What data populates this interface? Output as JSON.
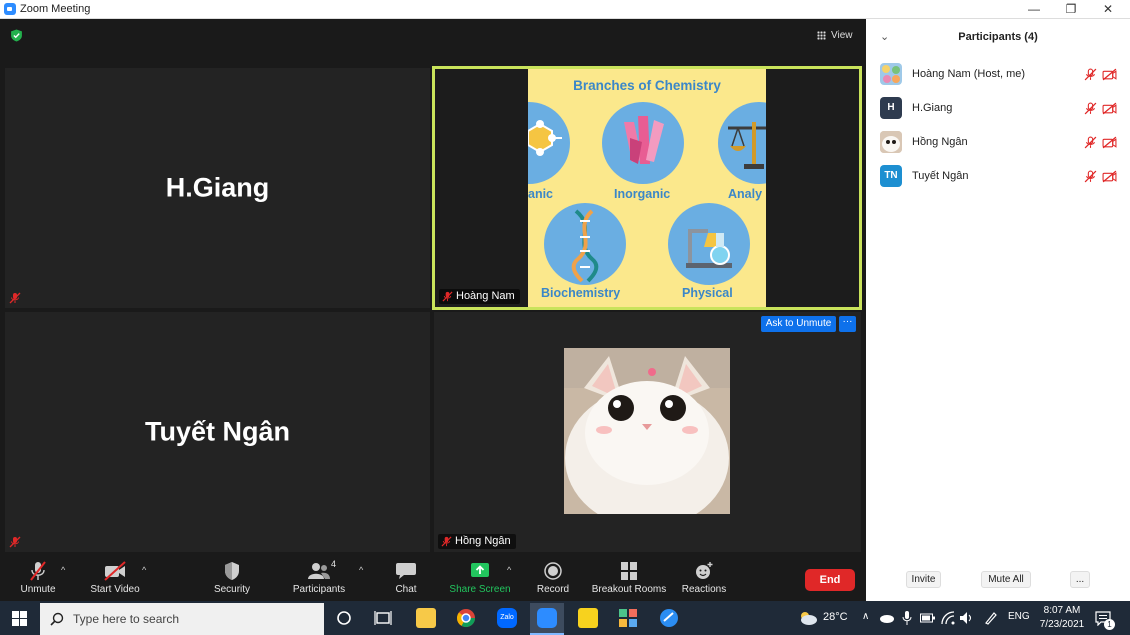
{
  "window": {
    "title": "Zoom Meeting",
    "minimize": "—",
    "restore": "❐",
    "close": "✕"
  },
  "stage": {
    "view_label": "View"
  },
  "tiles": {
    "h_giang": {
      "name": "H.Giang"
    },
    "tuyet_ngan": {
      "name": "Tuyết Ngân"
    },
    "hoang_nam": {
      "name": "Hoàng Nam"
    },
    "hong_ngan": {
      "name": "Hồng Ngân",
      "ask_unmute": "Ask to Unmute",
      "more": "···"
    }
  },
  "slide": {
    "title": "Branches of Chemistry",
    "labels": {
      "organic": "anic",
      "inorganic": "Inorganic",
      "analytical": "Analy",
      "biochemistry": "Biochemistry",
      "physical": "Physical"
    }
  },
  "toolbar": {
    "unmute": "Unmute",
    "start_video": "Start Video",
    "security": "Security",
    "participants": "Participants",
    "participants_count": "4",
    "chat": "Chat",
    "share_screen": "Share Screen",
    "record": "Record",
    "breakout_rooms": "Breakout Rooms",
    "reactions": "Reactions",
    "end": "End",
    "caret": "^"
  },
  "panel": {
    "title": "Participants (4)",
    "participants": [
      {
        "name": "Hoàng Nam (Host, me)",
        "avatar": "",
        "avatar_color": "#9fc9e8"
      },
      {
        "name": "H.Giang",
        "avatar": "H",
        "avatar_color": "#2e3b4f"
      },
      {
        "name": "Hồng Ngân",
        "avatar": "",
        "avatar_color": "#d9c7b5"
      },
      {
        "name": "Tuyết Ngân",
        "avatar": "TN",
        "avatar_color": "#1d8fd1"
      }
    ],
    "invite": "Invite",
    "mute_all": "Mute All",
    "more": "..."
  },
  "taskbar": {
    "search_placeholder": "Type here to search",
    "weather": "28°C",
    "language": "ENG",
    "time": "8:07 AM",
    "date": "7/23/2021",
    "notification_count": "1"
  },
  "colors": {
    "active_speaker_border": "#c9e35b",
    "end_button": "#e02828",
    "muted_icon": "#e02828",
    "ask_unmute_button": "#0e71eb",
    "share_screen": "#22c55e"
  }
}
